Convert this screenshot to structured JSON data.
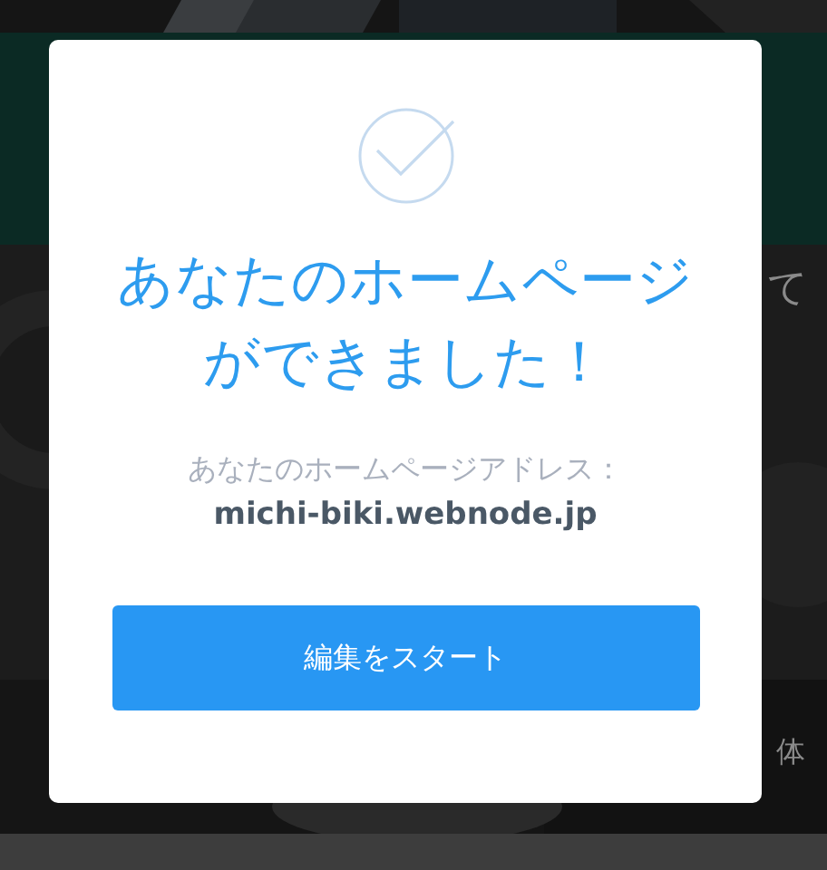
{
  "background": {
    "intro": [
      "て"
    ],
    "side_note": "体"
  },
  "dialog": {
    "title_lines": [
      "あなたのホームページ",
      "ができました！"
    ],
    "address_label": "あなたのホームページアドレス：",
    "address": "michi-biki.webnode.jp",
    "button": "編集をスタート"
  }
}
